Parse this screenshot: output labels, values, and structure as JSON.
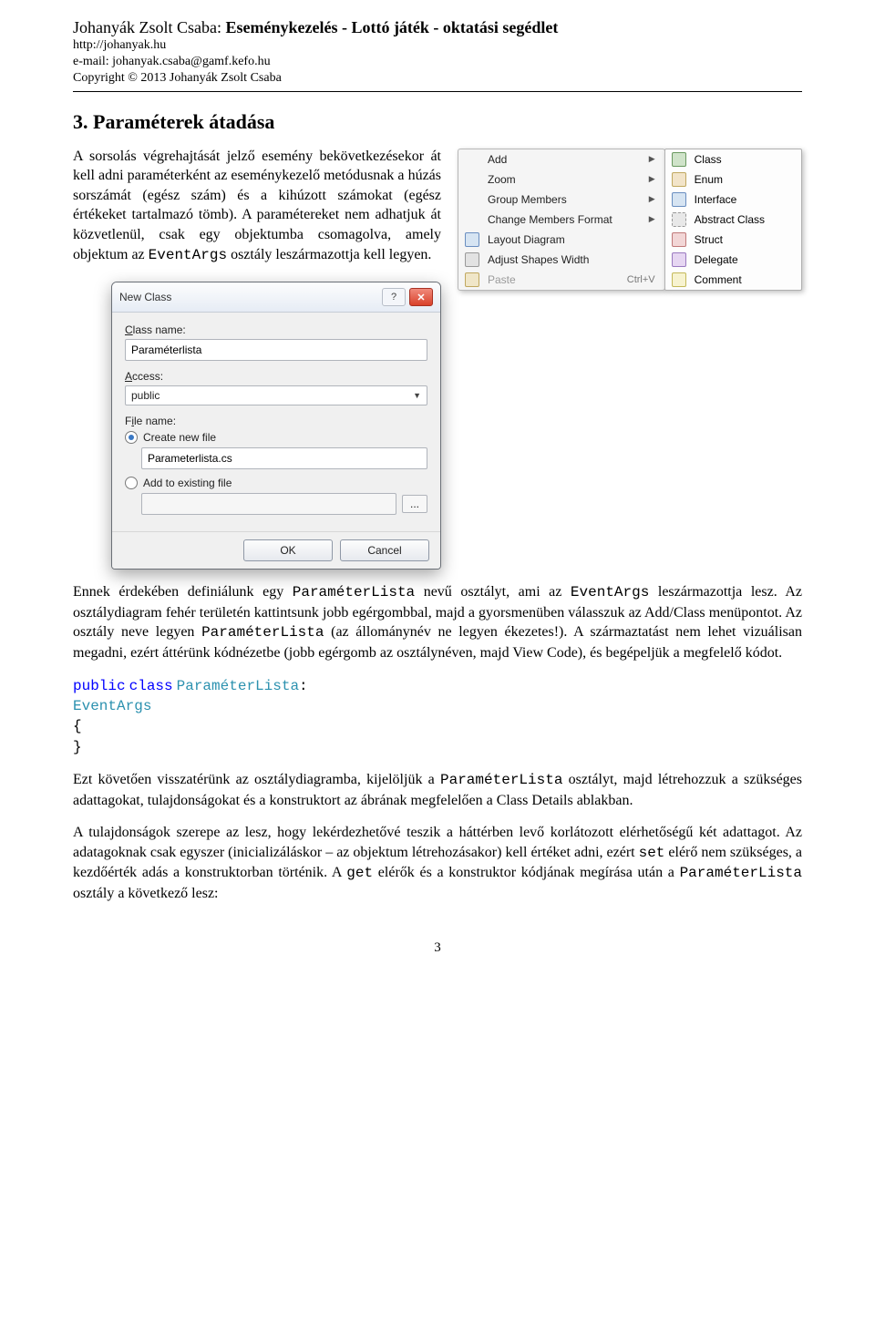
{
  "header": {
    "author": "Johanyák Zsolt Csaba: ",
    "title_bold": "Eseménykezelés - Lottó játék - oktatási segédlet",
    "url": "http://johanyak.hu",
    "email": "e-mail: johanyak.csaba@gamf.kefo.hu",
    "copyright": "Copyright © 2013 Johanyák Zsolt Csaba"
  },
  "section_heading": "3. Paraméterek átadása",
  "para1_a": "A sorsolás végrehajtását jelző esemény bekövetkezésekor át kell adni paraméterként az eseménykezelő metódusnak a húzás sorszámát (egész szám) és a kihúzott számokat (egész értékeket tartalmazó tömb). A paramétereket nem adhatjuk át közvetlenül, csak egy objektumba csomagolva, amely objektum az ",
  "para1_b": " osztály leszármazottja kell legyen.",
  "para2_a": "Ennek érdekében definiálunk egy ",
  "para2_b": " nevű osztályt, ami az ",
  "para2_c": " leszármazottja lesz. Az osztálydiagram fehér területén kattintsunk jobb egérgombbal, majd a gyorsmenüben válasszuk az Add/Class menüpontot. Az osztály neve legyen ",
  "para2_d": " (az állománynév ne legyen ékezetes!). A származtatást nem lehet vizuálisan megadni, ezért áttérünk kódnézetbe (jobb egérgomb az osztálynéven, majd View Code), és begépeljük a megfelelő kódot.",
  "code": {
    "kw_public": "public",
    "kw_class": "class",
    "cls_name": "ParaméterLista",
    "colon": ":",
    "base_name": "EventArgs",
    "brace_open": "{",
    "brace_close": "}"
  },
  "para3_a": "Ezt követően visszatérünk az osztálydiagramba, kijelöljük a ",
  "para3_b": " osztályt, majd létrehozzuk a szükséges adattagokat, tulajdonságokat és a konstruktort az ábrának megfelelően a Class Details ablakban.",
  "para4_a": "A tulajdonságok szerepe az lesz, hogy lekérdezhetővé teszik a háttérben levő korlátozott elérhetőségű két adattagot. Az adatagoknak csak egyszer (inicializáláskor – az objektum létrehozásakor) kell értéket adni, ezért ",
  "para4_b": " elérő nem szükséges, a kezdőérték adás a konstruktorban történik. A ",
  "para4_c": " elérők és a konstruktor kódjának megírása után a ",
  "para4_d": " osztály a következő lesz:",
  "mono_terms": {
    "EventArgs": "EventArgs",
    "ParameterLista": "ParaméterLista",
    "set": "set",
    "get": "get"
  },
  "context_menu": {
    "items": [
      {
        "label": "Add",
        "has_sub": true
      },
      {
        "label": "Zoom",
        "has_sub": true
      },
      {
        "label": "Group Members",
        "has_sub": true
      },
      {
        "label": "Change Members Format",
        "has_sub": true
      },
      {
        "label": "Layout Diagram",
        "icon": "layout"
      },
      {
        "label": "Adjust Shapes Width",
        "icon": "gray"
      },
      {
        "label": "Paste",
        "icon": "paste",
        "shortcut": "Ctrl+V",
        "disabled": true
      }
    ],
    "submenu": [
      {
        "label": "Class",
        "icon": "class"
      },
      {
        "label": "Enum",
        "icon": "enum"
      },
      {
        "label": "Interface",
        "icon": "interface"
      },
      {
        "label": "Abstract Class",
        "icon": "abstract"
      },
      {
        "label": "Struct",
        "icon": "struct"
      },
      {
        "label": "Delegate",
        "icon": "delegate"
      },
      {
        "label": "Comment",
        "icon": "comment"
      }
    ]
  },
  "dialog": {
    "title": "New Class",
    "label_class_name": "Class name:",
    "class_name_value": "Paraméterlista",
    "label_access": "Access:",
    "access_value": "public",
    "label_file_name": "File name:",
    "opt_create": "Create new file",
    "opt_create_file": "Parameterlista.cs",
    "opt_add": "Add to existing file",
    "opt_add_file": "",
    "browse": "...",
    "ok": "OK",
    "cancel": "Cancel"
  },
  "page_number": "3"
}
